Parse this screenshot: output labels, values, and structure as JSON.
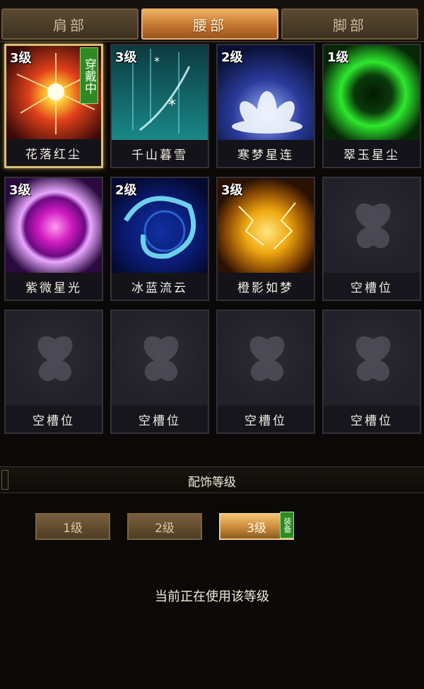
{
  "tabs": [
    {
      "label": "肩部",
      "active": false
    },
    {
      "label": "腰部",
      "active": true
    },
    {
      "label": "脚部",
      "active": false
    }
  ],
  "slots": [
    {
      "name": "花落红尘",
      "level": "3级",
      "badge": "穿戴中",
      "art": "red-sunburst"
    },
    {
      "name": "千山暮雪",
      "level": "3级",
      "badge": "",
      "art": "teal-snow"
    },
    {
      "name": "寒梦星连",
      "level": "2级",
      "badge": "",
      "art": "white-lotus"
    },
    {
      "name": "翠玉星尘",
      "level": "1级",
      "badge": "",
      "art": "green-orb"
    },
    {
      "name": "紫微星光",
      "level": "3级",
      "badge": "",
      "art": "purple-orb"
    },
    {
      "name": "冰蓝流云",
      "level": "2级",
      "badge": "",
      "art": "blue-swirl"
    },
    {
      "name": "橙影如梦",
      "level": "3级",
      "badge": "",
      "art": "gold-lightning"
    },
    {
      "name": "空槽位",
      "level": "",
      "badge": "",
      "art": "empty-moth"
    },
    {
      "name": "空槽位",
      "level": "",
      "badge": "",
      "art": "empty-moth"
    },
    {
      "name": "空槽位",
      "level": "",
      "badge": "",
      "art": "empty-moth"
    },
    {
      "name": "空槽位",
      "level": "",
      "badge": "",
      "art": "empty-moth"
    },
    {
      "name": "空槽位",
      "level": "",
      "badge": "",
      "art": "empty-moth"
    }
  ],
  "section": {
    "title": "配饰等级"
  },
  "levels": [
    {
      "label": "1级",
      "active": false
    },
    {
      "label": "2级",
      "active": false
    },
    {
      "label": "3级",
      "active": true
    }
  ],
  "equip_tag": "装备",
  "status_text": "当前正在使用该等级",
  "colors": {
    "accent": "#d98a3a",
    "equipped_green": "#2f8a26",
    "selected_border": "#d9bf7a"
  }
}
